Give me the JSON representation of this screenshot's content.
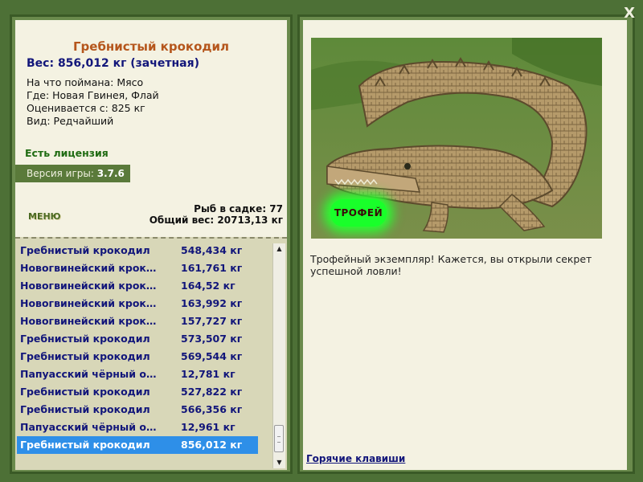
{
  "window": {
    "close_label": "X"
  },
  "fish_info": {
    "name": "Гребнистый крокодил",
    "weight": "Вес: 856,012 кг (зачетная)",
    "bait": "На что поймана: Мясо",
    "location": "Где: Новая Гвинея, Флай",
    "evaluated_from": "Оценивается с: 825 кг",
    "rarity": "Вид: Редчайший",
    "license": "Есть лицензия",
    "version_label": "Версия игры:",
    "version_value": "3.7.6"
  },
  "menu_label": "МЕНЮ",
  "keep_net": {
    "fish_count": "Рыб в садке: 77",
    "total_weight": "Общий вес: 20713,13 кг"
  },
  "catch_list": [
    {
      "name": "Гребнистый крокодил",
      "weight": "548,434 кг"
    },
    {
      "name": "Новогвинейский крокодил",
      "weight": "161,761 кг"
    },
    {
      "name": "Новогвинейский крокодил",
      "weight": "164,52 кг"
    },
    {
      "name": "Новогвинейский крокодил",
      "weight": "163,992 кг"
    },
    {
      "name": "Новогвинейский крокодил",
      "weight": "157,727 кг"
    },
    {
      "name": "Гребнистый крокодил",
      "weight": "573,507 кг"
    },
    {
      "name": "Гребнистый крокодил",
      "weight": "569,544 кг"
    },
    {
      "name": "Папуасский чёрный окунь",
      "weight": "12,781 кг"
    },
    {
      "name": "Гребнистый крокодил",
      "weight": "527,822 кг"
    },
    {
      "name": "Гребнистый крокодил",
      "weight": "566,356 кг"
    },
    {
      "name": "Папуасский чёрный окунь",
      "weight": "12,961 кг"
    },
    {
      "name": "Гребнистый крокодил",
      "weight": "856,012 кг",
      "selected": true
    }
  ],
  "trophy": {
    "badge": "ТРОФЕЙ",
    "message": "Трофейный экземпляр! Кажется, вы открыли секрет успешной ловли!"
  },
  "hotkeys_label": "Горячие клавиши",
  "colors": {
    "background": "#4d7036",
    "panel": "#f4f2e2",
    "list_bg": "#d8d7b8",
    "accent_name": "#b5561c",
    "text_blue": "#12167a",
    "selection": "#2e8fe8",
    "license_green": "#1f6b12",
    "trophy_glow": "#2aff32"
  }
}
